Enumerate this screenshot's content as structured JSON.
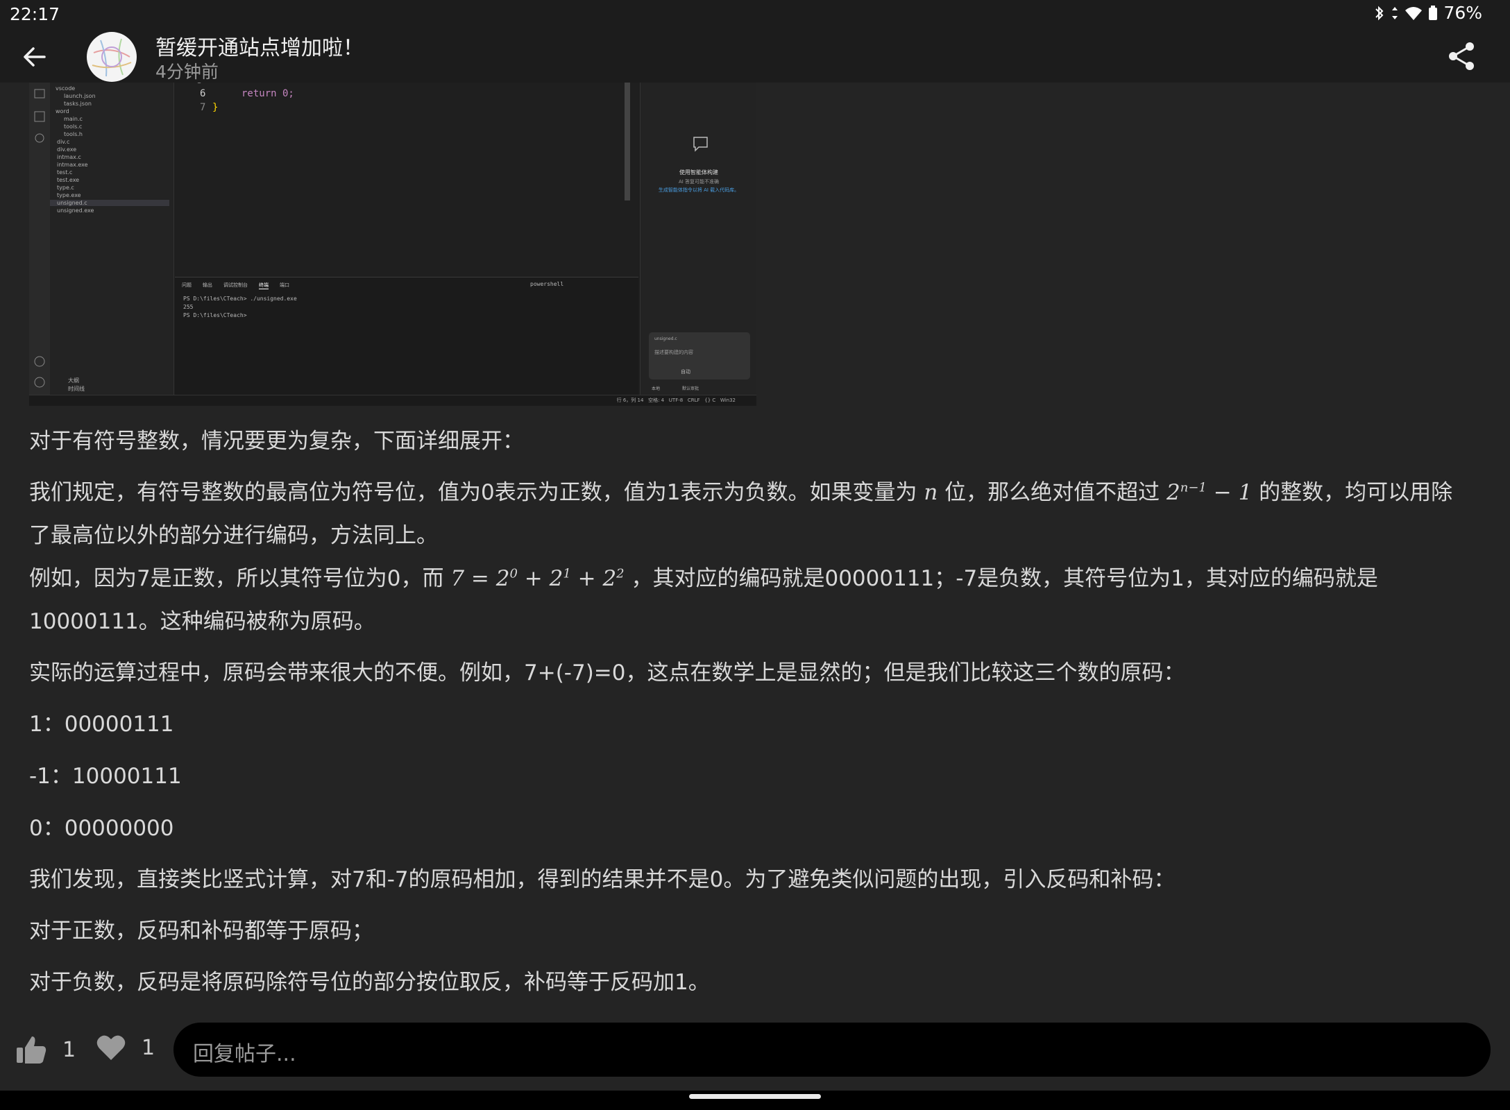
{
  "status": {
    "time": "22:17",
    "battery": "76%"
  },
  "header": {
    "title": "暂缓开通站点增加啦！",
    "time": "4分钟前"
  },
  "screenshot": {
    "files": [
      "vscode",
      "launch.json",
      "tasks.json",
      "word",
      "main.c",
      "tools.c",
      "tools.h",
      "div.c",
      "div.exe",
      "intmax.c",
      "intmax.exe",
      "test.c",
      "test.exe",
      "type.c",
      "type.exe",
      "unsigned.c",
      "unsigned.exe"
    ],
    "code_lines": [
      {
        "num": "6",
        "text": "return 0;"
      },
      {
        "num": "7",
        "text": "}"
      }
    ],
    "terminal_tabs": [
      "问题",
      "输出",
      "调试控制台",
      "终端",
      "端口"
    ],
    "terminal_shell": "powershell",
    "terminal_lines": [
      "PS D:\\files\\CTeach> ./unsigned.exe",
      "255",
      "PS D:\\files\\CTeach> "
    ],
    "chat_title": "使用智能体构建",
    "chat_sub1": "AI 答复可能不准确",
    "chat_sub2": "生成智能体指令以将 AI 载入代码库。",
    "chat_file": "unsigned.c",
    "chat_placeholder": "描述要构建的内容",
    "chat_mode": "自动",
    "chat_opt1": "本地",
    "chat_opt2": "默认审批",
    "outline": "大纲",
    "timeline": "时间线",
    "statusline_right": "行 6，列 14   空格: 4   UTF-8   CRLF   {} C   Win32"
  },
  "article": {
    "p1": "对于有符号整数，情况要更为复杂，下面详细展开：",
    "p2a": "我们规定，有符号整数的最高位为符号位，值为0表示为正数，值为1表示为负数。如果变量为",
    "p2_var": "n",
    "p2b": "位，那么绝对值不超过",
    "p2_math": "2",
    "p2_math_exp": "n−1",
    "p2_math_tail": "− 1",
    "p2c": "的整数，均可以用除",
    "p2d": "了最高位以外的部分进行编码，方法同上。",
    "p3a": "例如，因为7是正数，所以其符号位为0，而",
    "p3_math": "7 = 2",
    "p3_e0": "0",
    "p3_m2": " + 2",
    "p3_e1": "1",
    "p3_m3": " + 2",
    "p3_e2": "2",
    "p3b": "，其对应的编码就是00000111；-7是负数，其符号位为1，其对应的编码就是",
    "p3c": "10000111。这种编码被称为原码。",
    "p4": "实际的运算过程中，原码会带来很大的不便。例如，7+(-7)=0，这点在数学上是显然的；但是我们比较这三个数的原码：",
    "l1": "1：00000111",
    "l2": "-1：10000111",
    "l3": "0：00000000",
    "p5": "我们发现，直接类比竖式计算，对7和-7的原码相加，得到的结果并不是0。为了避免类似问题的出现，引入反码和补码：",
    "p6": "对于正数，反码和补码都等于原码；",
    "p7": "对于负数，反码是将原码除符号位的部分按位取反，补码等于反码加1。"
  },
  "footer": {
    "like_count": "1",
    "fav_count": "1",
    "reply_placeholder": "回复帖子..."
  }
}
